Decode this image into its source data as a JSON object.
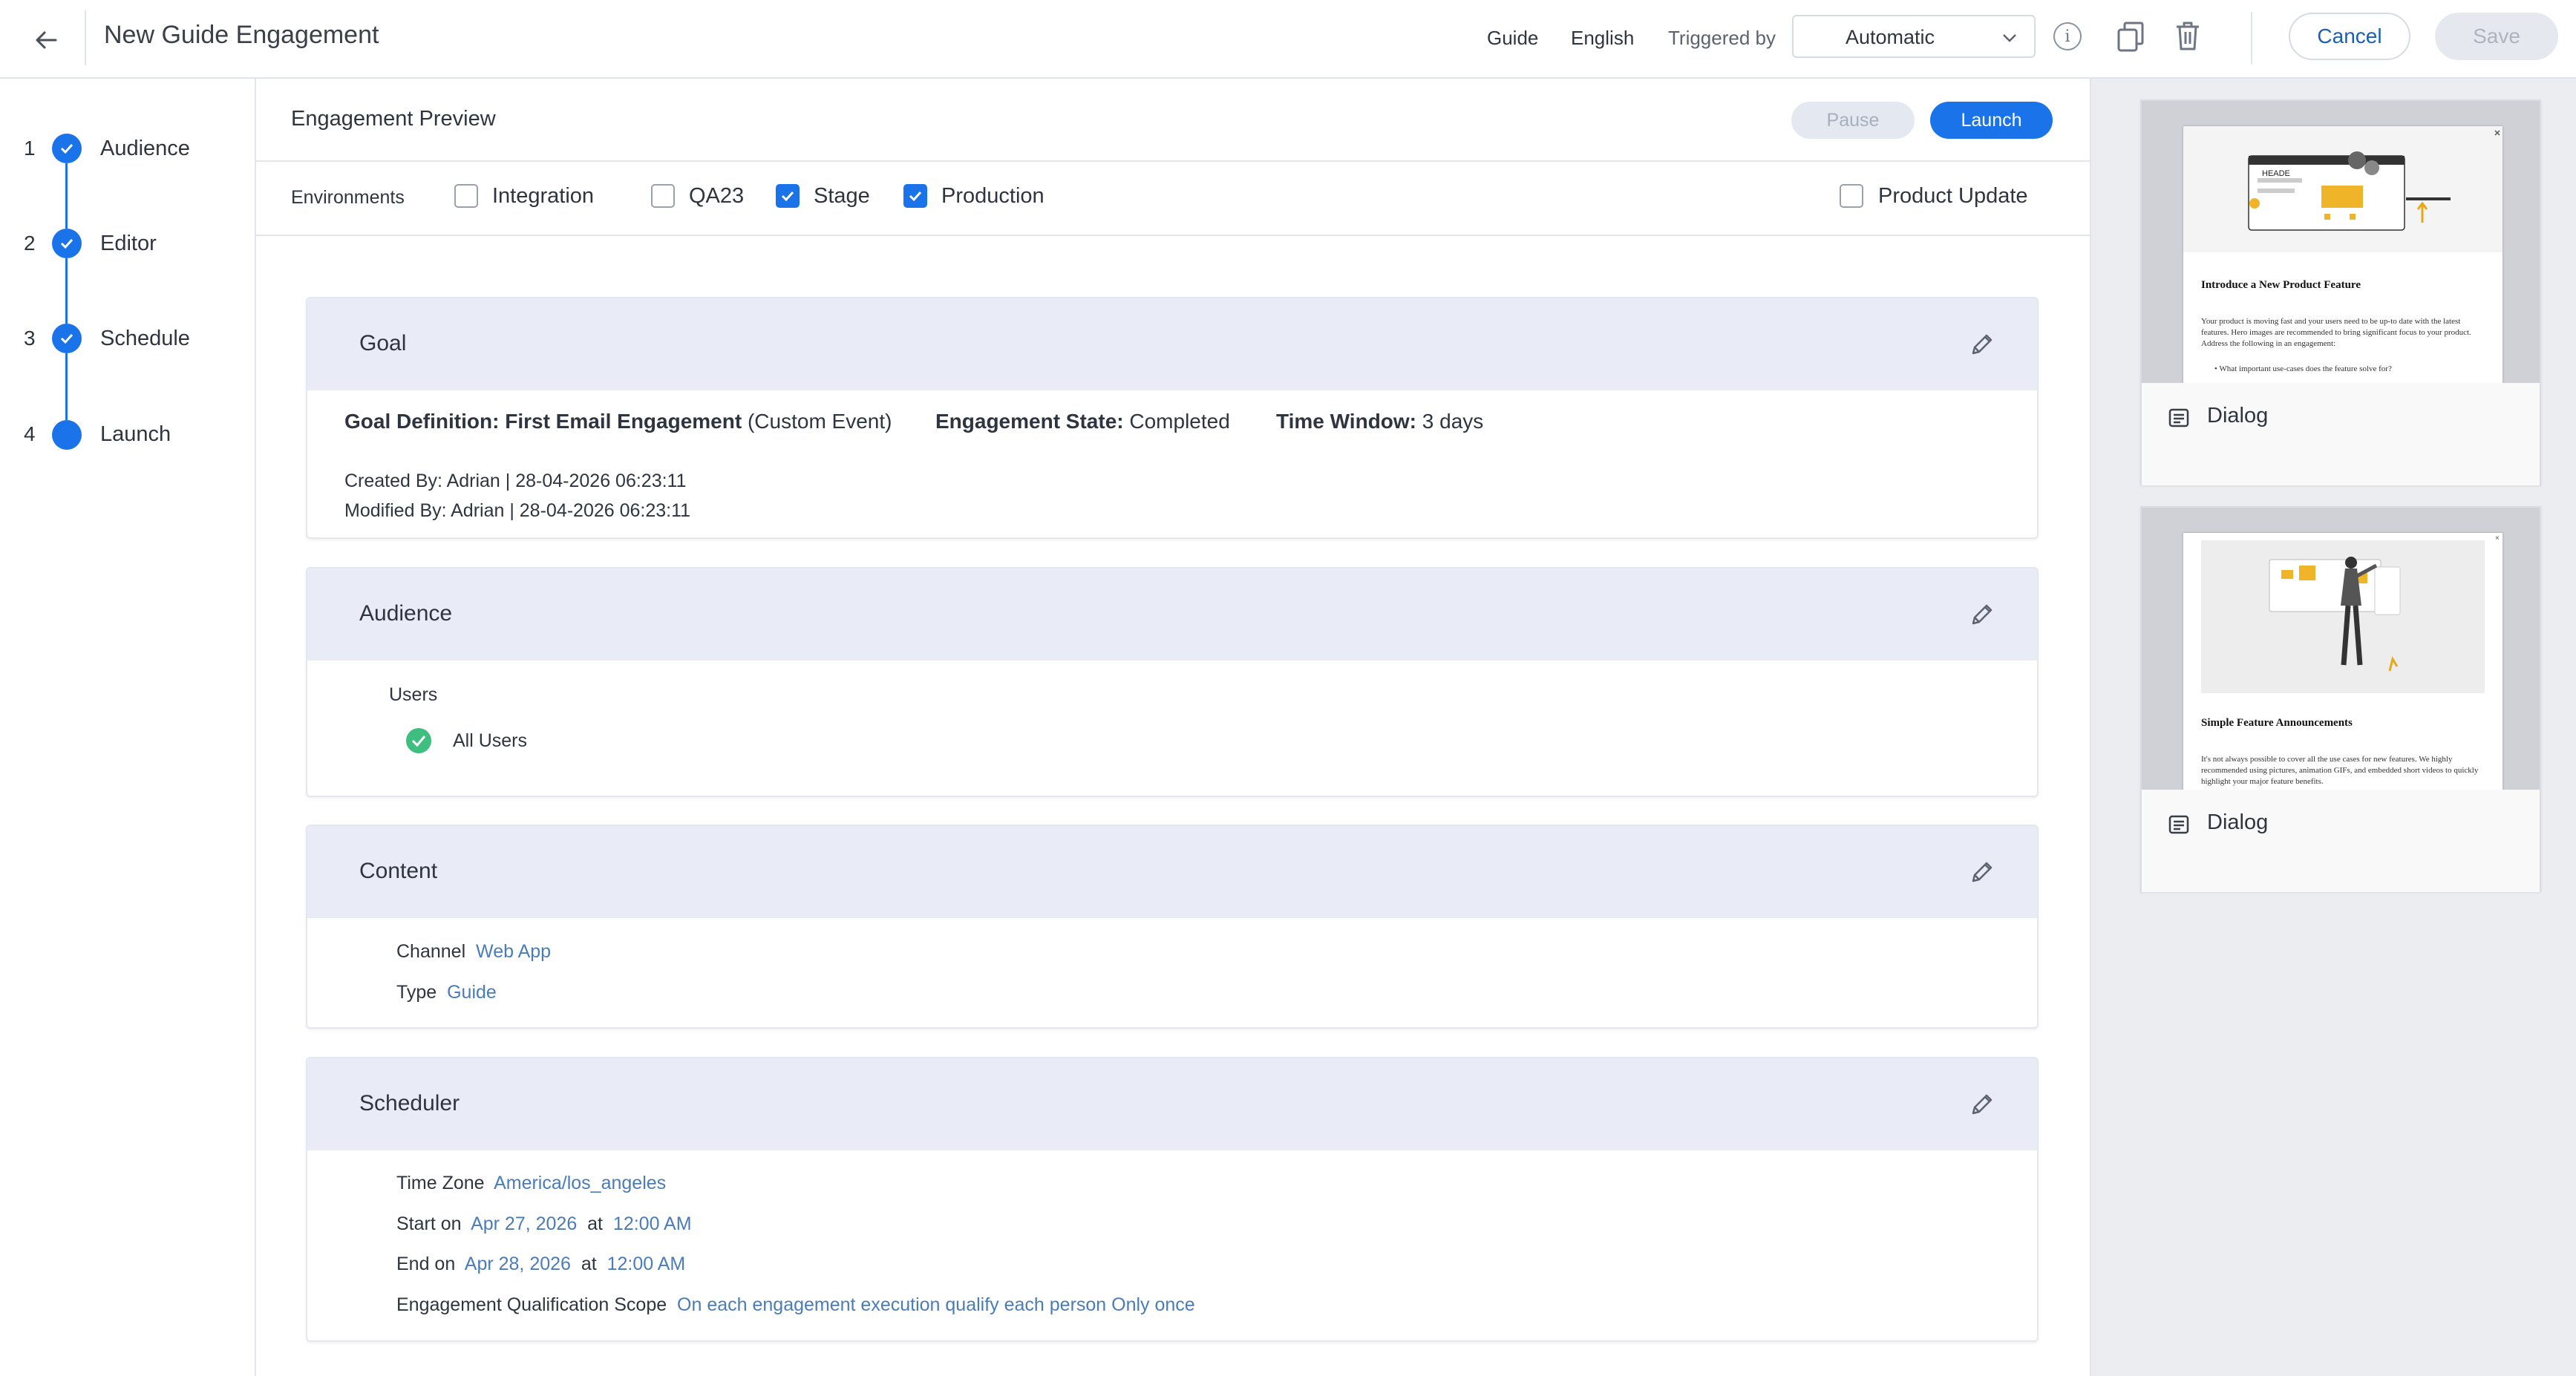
{
  "header": {
    "title": "New Guide Engagement",
    "type_label": "Guide",
    "language_label": "English",
    "triggered_by_label": "Triggered by",
    "trigger_value": "Automatic",
    "info_glyph": "i",
    "cancel_label": "Cancel",
    "save_label": "Save"
  },
  "stepper": {
    "steps": [
      {
        "number": "1",
        "label": "Audience",
        "state": "done"
      },
      {
        "number": "2",
        "label": "Editor",
        "state": "done"
      },
      {
        "number": "3",
        "label": "Schedule",
        "state": "done"
      },
      {
        "number": "4",
        "label": "Launch",
        "state": "current"
      }
    ]
  },
  "preview": {
    "title": "Engagement Preview",
    "pause_label": "Pause",
    "launch_label": "Launch"
  },
  "environments": {
    "label": "Environments",
    "options": [
      {
        "label": "Integration",
        "checked": false
      },
      {
        "label": "QA23",
        "checked": false
      },
      {
        "label": "Stage",
        "checked": true
      },
      {
        "label": "Production",
        "checked": true
      }
    ],
    "product_update": {
      "label": "Product Update",
      "checked": false
    }
  },
  "goal": {
    "title": "Goal",
    "definition_label": "Goal Definition:",
    "definition_value": "First Email Engagement",
    "definition_suffix": "(Custom Event)",
    "state_label": "Engagement State:",
    "state_value": "Completed",
    "window_label": "Time Window:",
    "window_value": "3 days",
    "created": "Created By: Adrian | 28-04-2026 06:23:11",
    "modified": "Modified By: Adrian | 28-04-2026 06:23:11"
  },
  "audience": {
    "title": "Audience",
    "users_label": "Users",
    "users_value": "All Users"
  },
  "content": {
    "title": "Content",
    "channel_label": "Channel",
    "channel_value": "Web App",
    "type_label": "Type",
    "type_value": "Guide"
  },
  "scheduler": {
    "title": "Scheduler",
    "timezone_label": "Time Zone",
    "timezone_value": "America/los_angeles",
    "start_label": "Start on",
    "start_date": "Apr 27, 2026",
    "start_at": "at",
    "start_time": "12:00 AM",
    "end_label": "End on",
    "end_date": "Apr 28, 2026",
    "end_at": "at",
    "end_time": "12:00 AM",
    "scope_label": "Engagement Qualification Scope",
    "scope_value": "On each engagement execution qualify each person Only once"
  },
  "templates": [
    {
      "caption": "Dialog",
      "icon": "dialog-icon",
      "doc_title": "Introduce a New Product Feature",
      "doc_body": "Your product is moving fast and your users need to be up-to date with the latest features. Hero images are recommended to bring significant focus to your product. Address the following in an engagement:",
      "doc_bullet": "What important use-cases does the feature solve for?",
      "doc_header_word": "HEADE"
    },
    {
      "caption": "Dialog",
      "icon": "dialog-icon",
      "doc_title": "Simple Feature Announcements",
      "doc_body": "It's not always possible to cover all the use cases for new features. We highly recommended using pictures, animation GIFs, and embedded short videos to quickly highlight your major feature benefits."
    }
  ],
  "colors": {
    "accent": "#1a73e8",
    "card_header": "#e9ebf7",
    "link": "#4a7cb8",
    "success": "#3fbf7f"
  }
}
